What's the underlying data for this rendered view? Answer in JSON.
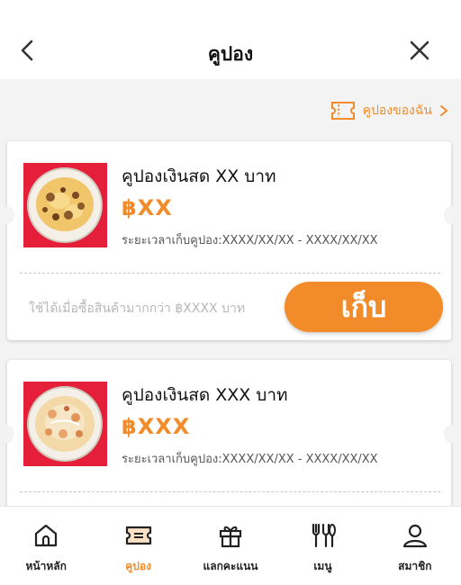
{
  "header": {
    "title": "คูปอง"
  },
  "my_coupons_link": "คูปองของฉัน",
  "coupons": [
    {
      "title": "คูปองเงินสด XX บาท",
      "amount": "฿XX",
      "period": "ระยะเวลาเก็บคูปอง:XXXX/XX/XX - XXXX/XX/XX",
      "condition": "ใช้ได้เมื่อซื้อสินค้ามากกว่า ฿XXXX บาท",
      "button": "เก็บ"
    },
    {
      "title": "คูปองเงินสด XXX บาท",
      "amount": "฿XXX",
      "period": "ระยะเวลาเก็บคูปอง:XXXX/XX/XX - XXXX/XX/XX"
    }
  ],
  "nav": {
    "items": [
      {
        "label": "หน้าหลัก",
        "icon": "home-icon"
      },
      {
        "label": "คูปอง",
        "icon": "coupon-icon",
        "active": true
      },
      {
        "label": "แลกคะแนน",
        "icon": "gift-icon"
      },
      {
        "label": "เมนู",
        "icon": "utensils-icon"
      },
      {
        "label": "สมาชิก",
        "icon": "user-icon"
      }
    ]
  },
  "colors": {
    "accent": "#f28c2a",
    "thumb_bg": "#e51f3a",
    "page_bg": "#f3f3f3"
  }
}
